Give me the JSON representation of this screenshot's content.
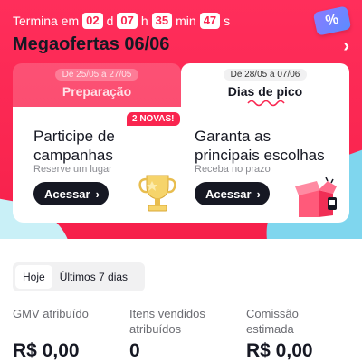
{
  "countdown": {
    "prefix": "Termina em",
    "days": "02",
    "days_unit": "d",
    "hours": "07",
    "hours_unit": "h",
    "minutes": "35",
    "minutes_unit": "min",
    "seconds": "47",
    "seconds_unit": "s"
  },
  "coupon_icon": "%",
  "title": "Megaofertas 06/06",
  "phases": [
    {
      "dates": "De 25/05 a 27/05",
      "label": "Preparação"
    },
    {
      "dates": "De 28/05 a 07/06",
      "label": "Dias de pico"
    }
  ],
  "badge": "2 NOVAS!",
  "columns": [
    {
      "title_line1": "Participe de",
      "title_line2": "campanhas",
      "subtitle": "Reserve um lugar",
      "button": "Acessar",
      "illustration": "trophy-icon"
    },
    {
      "title_line1": "Garanta as",
      "title_line2": "principais escolhas",
      "subtitle": "Receba no prazo",
      "button": "Acessar",
      "illustration": "gift-box-icon"
    }
  ],
  "range_tabs": [
    "Hoje",
    "Últimos 7 dias"
  ],
  "range_selected": "Hoje",
  "metrics": [
    {
      "label_line1": "GMV atribuído",
      "label_line2": "",
      "value": "R$ 0,00"
    },
    {
      "label_line1": "Itens vendidos",
      "label_line2": "atribuídos",
      "value": "0"
    },
    {
      "label_line1": "Comissão",
      "label_line2": "estimada",
      "value": "R$ 0,00"
    }
  ],
  "colors": {
    "accent": "#f9254f",
    "dark": "#161823",
    "muted": "#8a8b91"
  }
}
